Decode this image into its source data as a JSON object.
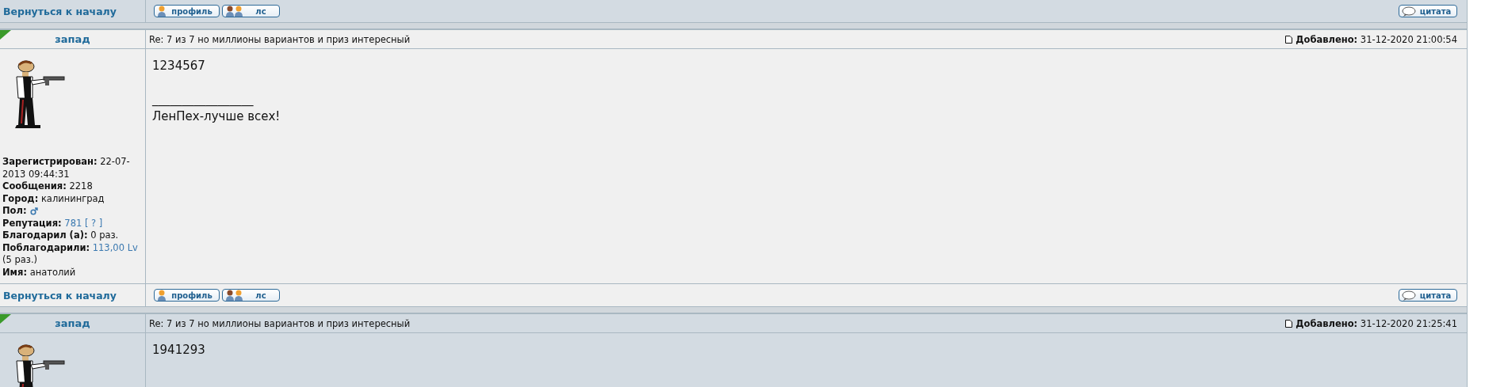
{
  "rows": [
    {
      "kind": "footer",
      "dark": true,
      "back_link": "Вернуться к началу",
      "buttons": [
        {
          "kind": "profile",
          "label": "профиль"
        },
        {
          "kind": "pm",
          "label": "лс"
        }
      ],
      "quote_button": "цитата"
    },
    {
      "kind": "post",
      "dark": false,
      "unread": true,
      "author": "запад",
      "subject": "Re: 7 из 7 но миллионы вариантов и приз интересный",
      "added_label": "Добавлено:",
      "added": "31-12-2020 21:00:54",
      "message": [
        "1234567"
      ],
      "signature_rule": "_________________",
      "signature": "ЛенПех-лучше всех!",
      "profile": [
        {
          "label": "Зарегистрирован:",
          "parts": [
            {
              "text": "22-07-2013 09:44:31",
              "link": false
            }
          ]
        },
        {
          "label": "Сообщения:",
          "parts": [
            {
              "text": "2218",
              "link": false
            }
          ]
        },
        {
          "label": "Город:",
          "parts": [
            {
              "text": "калининград",
              "link": false
            }
          ]
        },
        {
          "label": "Пол:",
          "male": true
        },
        {
          "label": "Репутация:",
          "parts": [
            {
              "text": "781",
              "link": true
            },
            {
              "text": "[ ? ]",
              "link": true
            }
          ]
        },
        {
          "label": "Благодарил (а):",
          "parts": [
            {
              "text": "0 раз.",
              "link": false
            }
          ]
        },
        {
          "label": "Поблагодарили:",
          "parts": [
            {
              "text": "113,00 Lv",
              "link": true
            },
            {
              "text": "(5 раз.)",
              "link": false
            }
          ]
        },
        {
          "label": "Имя:",
          "parts": [
            {
              "text": "анатолий",
              "link": false
            }
          ]
        }
      ]
    },
    {
      "kind": "footer",
      "dark": false,
      "back_link": "Вернуться к началу",
      "buttons": [
        {
          "kind": "profile",
          "label": "профиль"
        },
        {
          "kind": "pm",
          "label": "лс"
        }
      ],
      "quote_button": "цитата"
    },
    {
      "kind": "post",
      "dark": true,
      "unread": true,
      "author": "запад",
      "subject": "Re: 7 из 7 но миллионы вариантов и приз интересный",
      "added_label": "Добавлено:",
      "added": "31-12-2020 21:25:41",
      "message": [
        "1941293"
      ],
      "profile": []
    }
  ]
}
